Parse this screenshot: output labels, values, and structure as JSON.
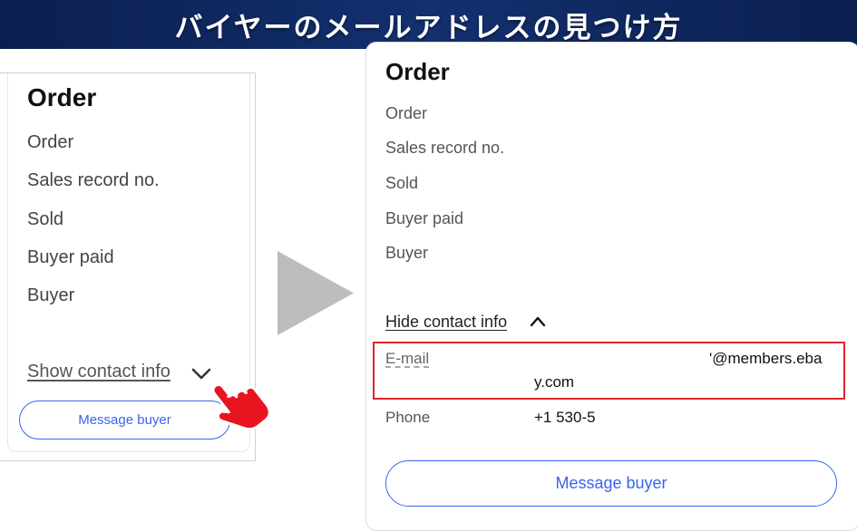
{
  "banner": {
    "title": "バイヤーのメールアドレスの見つけ方"
  },
  "left_panel": {
    "heading": "Order",
    "rows": [
      "Order",
      "Sales record no.",
      "Sold",
      "Buyer paid",
      "Buyer"
    ],
    "show_contact_label": "Show contact info",
    "message_button": "Message buyer"
  },
  "right_panel": {
    "heading": "Order",
    "rows": [
      "Order",
      "Sales record no.",
      "Sold",
      "Buyer paid",
      "Buyer"
    ],
    "hide_contact_label": "Hide contact info",
    "email_label": "E-mail",
    "email_value_line1": "'@members.eba",
    "email_value_line2": "y.com",
    "phone_label": "Phone",
    "phone_value": "+1 530-5",
    "message_button": "Message buyer"
  },
  "colors": {
    "banner": "#13306f",
    "accent_blue": "#3665f3",
    "highlight_red": "#e0252a",
    "arrow_gray": "#bdbdbd"
  }
}
